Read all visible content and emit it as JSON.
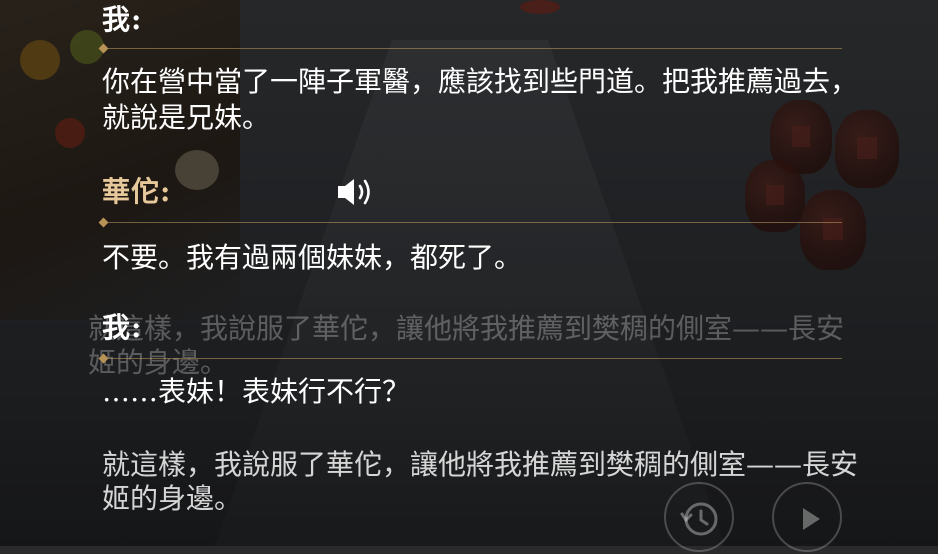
{
  "dialogue": [
    {
      "speaker": "我:",
      "text": "你在營中當了一陣子軍醫，應該找到些門道。把我推薦過去，就說是兄妹。"
    },
    {
      "speaker": "華佗:",
      "text": "不要。我有過兩個妹妹，都死了。"
    },
    {
      "speaker": "我:",
      "text": "……表妹！表妹行不行？"
    }
  ],
  "narration": "就這樣，我說服了華佗，讓他將我推薦到樊稠的側室——長安姬的身邊。",
  "ghost_narration": "就這樣，我說服了華佗，讓他將我推薦到樊稠的側室——長安姬的身邊。",
  "icons": {
    "voice": "speaker-volume-icon",
    "history": "history-clock-icon",
    "auto_play": "play-icon"
  },
  "colors": {
    "player_name": "#ffffff",
    "npc_name": "#e6c89a",
    "divider": "#b89358"
  }
}
